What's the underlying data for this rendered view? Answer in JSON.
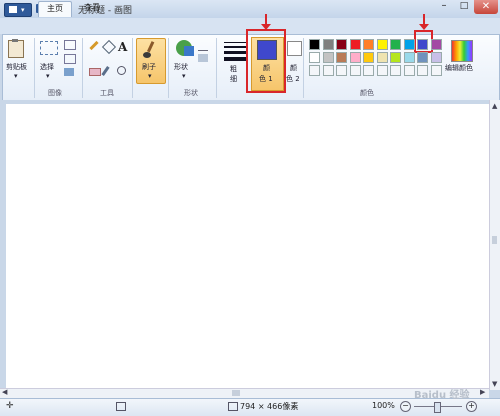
{
  "window": {
    "title": "无标题 - 画图"
  },
  "tabs": [
    {
      "label": "主页"
    },
    {
      "label": "查看"
    }
  ],
  "ribbon": {
    "groups": {
      "clipboard": {
        "button_label": "剪贴板"
      },
      "image": {
        "label": "图像",
        "select_label": "选择"
      },
      "tools": {
        "label": "工具",
        "text_glyph": "A"
      },
      "brush": {
        "label": "刷子"
      },
      "shapes": {
        "label": "形状",
        "button_label": "形状"
      },
      "size": {
        "label_top": "粗",
        "label_bottom": "细"
      },
      "color1": {
        "label_top": "颜",
        "label_bottom": "色 1",
        "value": "#3f48cc"
      },
      "color2": {
        "label_top": "颜",
        "label_bottom": "色 2",
        "value": "#ffffff"
      },
      "colors": {
        "label": "颜色"
      },
      "edit_colors": {
        "label": "编辑颜色"
      }
    },
    "palette_row1": [
      "#000000",
      "#7f7f7f",
      "#880015",
      "#ed1c24",
      "#ff7f27",
      "#fff200",
      "#22b14c",
      "#00a2e8",
      "#3f48cc",
      "#a349a4"
    ],
    "palette_row2": [
      "#ffffff",
      "#c3c3c3",
      "#b97a57",
      "#ffaec9",
      "#ffc90e",
      "#efe4b0",
      "#b5e61d",
      "#99d9ea",
      "#7092be",
      "#c8bfe7"
    ],
    "palette_row3_count": 10
  },
  "status": {
    "canvas_size": "794 × 466像素",
    "zoom": "100%"
  },
  "annotation_color": "#d9262a",
  "watermark": "Baidu 经验"
}
